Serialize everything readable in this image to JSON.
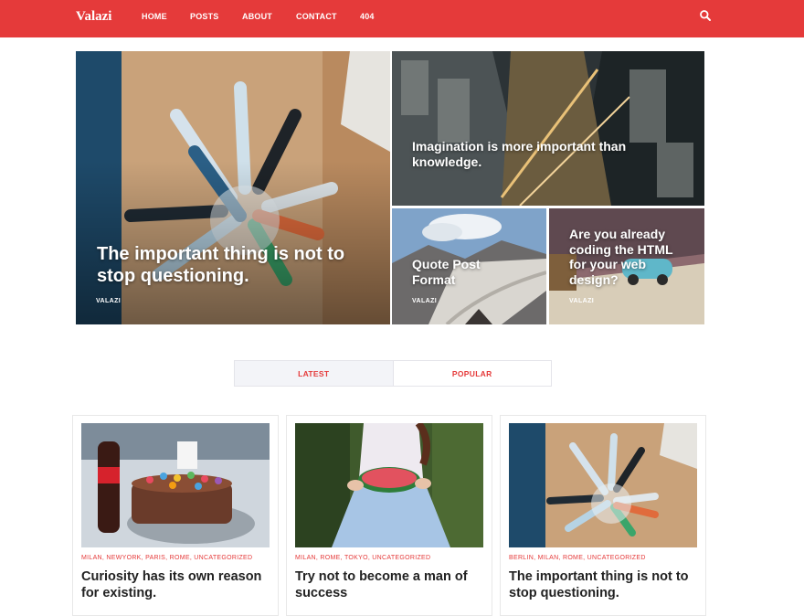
{
  "header": {
    "logo": "Valazi",
    "nav": [
      "HOME",
      "POSTS",
      "ABOUT",
      "CONTACT",
      "404"
    ],
    "accent_color": "#e53a3a",
    "search_icon": "search-icon"
  },
  "hero": {
    "main": {
      "title": "The important thing is not to stop questioning.",
      "author": "VALAZI"
    },
    "top_right": {
      "title": "Imagination is more important than knowledge."
    },
    "bottom_left": {
      "title": "Quote Post Format",
      "author": "VALAZI"
    },
    "bottom_right": {
      "title": "Are you already coding the HTML for your web design?",
      "author": "VALAZI"
    }
  },
  "tabs": [
    "LATEST",
    "POPULAR"
  ],
  "cards": [
    {
      "categories": "MILAN, NEWYORK, PARIS, ROME, UNCATEGORIZED",
      "title": "Curiosity has its own reason for existing."
    },
    {
      "categories": "MILAN, ROME, TOKYO, UNCATEGORIZED",
      "title": "Try not to become a man of success"
    },
    {
      "categories": "BERLIN, MILAN, ROME, UNCATEGORIZED",
      "title": "The important thing is not to stop questioning."
    }
  ]
}
